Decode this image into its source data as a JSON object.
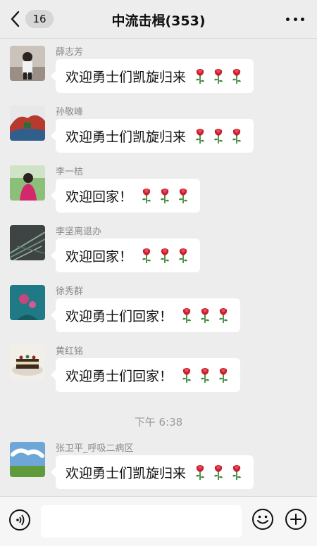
{
  "header": {
    "unread_count": "16",
    "title": "中流击楫(353)"
  },
  "messages": [
    {
      "sender": "薛志芳",
      "text": "欢迎勇士们凯旋归来",
      "roses": 3
    },
    {
      "sender": "孙敬峰",
      "text": "欢迎勇士们凯旋归来",
      "roses": 3
    },
    {
      "sender": "李一桔",
      "text": "欢迎回家！",
      "roses": 3
    },
    {
      "sender": "李坚离退办",
      "text": "欢迎回家！",
      "roses": 3
    },
    {
      "sender": "徐秀群",
      "text": "欢迎勇士们回家！",
      "roses": 3
    },
    {
      "sender": "黄红铭",
      "text": "欢迎勇士们回家！",
      "roses": 3
    },
    {
      "sender": "张卫平_呼吸二病区",
      "text": "欢迎勇士们凯旋归来",
      "roses": 3
    }
  ],
  "timestamp": "下午 6:38",
  "input": {
    "value": ""
  },
  "icons": {
    "back": "chevron-left-icon",
    "more": "more-dots-icon",
    "voice": "voice-icon",
    "emoji": "emoji-icon",
    "plus": "plus-icon",
    "rose": "rose-icon"
  }
}
